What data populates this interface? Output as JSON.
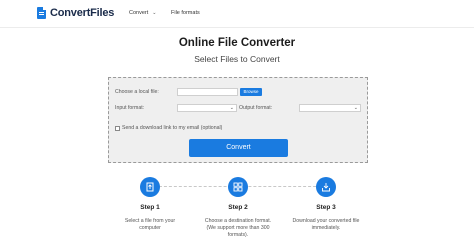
{
  "brand": {
    "name": "ConvertFiles",
    "color": "#1a7be0"
  },
  "nav": {
    "convert_label": "Convert",
    "file_formats_label": "File formats"
  },
  "main": {
    "title": "Online File Converter",
    "subtitle": "Select Files to Convert"
  },
  "form": {
    "choose_file_label": "Choose a local file:",
    "browse_label": "Browse",
    "input_format_label": "Input format:",
    "output_format_label": "Output format:",
    "email_checkbox_label": "Send a download link to my email (optional)",
    "convert_label": "Convert"
  },
  "steps": [
    {
      "title": "Step 1",
      "desc1": "Select a file from your",
      "desc2": "computer",
      "desc3": "",
      "icon": "file-upload-icon"
    },
    {
      "title": "Step 2",
      "desc1": "Choose a destination format.",
      "desc2": "(We support more than 300",
      "desc3": "formats).",
      "icon": "grid-icon"
    },
    {
      "title": "Step 3",
      "desc1": "Download your converted file",
      "desc2": "immediately.",
      "desc3": "",
      "icon": "download-icon"
    }
  ]
}
